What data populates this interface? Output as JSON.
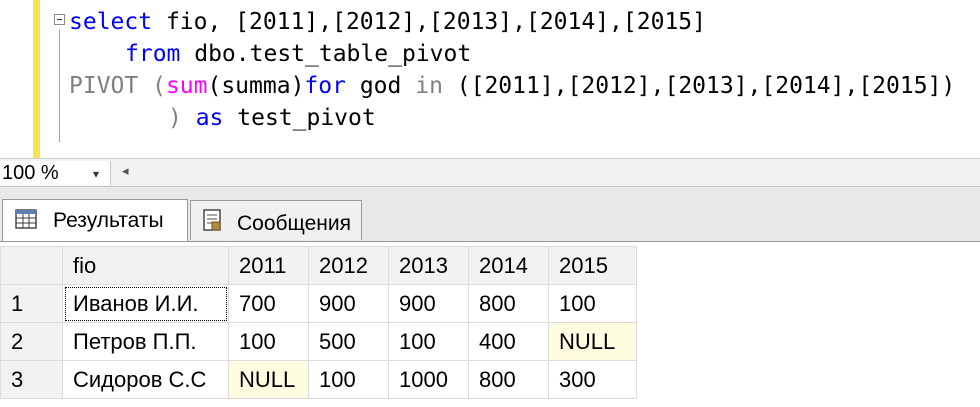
{
  "editor": {
    "lines": [
      {
        "kw1": "select",
        "t1": " fio, [2011],[2012],[2013],[2014],[2015]"
      },
      {
        "kw1": "from",
        "t1": " dbo.test_table_pivot"
      },
      {
        "g1": "PIVOT (",
        "fn1": "sum",
        "t1": "(summa)",
        "kw1": "for",
        "t2": " god ",
        "g2": "in",
        "t3": " ([2011],[2012],[2013],[2014],[2015])"
      },
      {
        "g1": ")",
        "kw1": " as",
        "t1": " test_pivot"
      }
    ]
  },
  "zoom": {
    "value": "100 %",
    "arrow": "▾",
    "scroll_left": "◂"
  },
  "tabs": [
    {
      "label": "Результаты"
    },
    {
      "label": "Сообщения"
    }
  ],
  "grid": {
    "headers": [
      "",
      "fio",
      "2011",
      "2012",
      "2013",
      "2014",
      "2015"
    ],
    "rows": [
      {
        "num": "1",
        "fio": "Иванов И.И.",
        "v2011": "700",
        "v2012": "900",
        "v2013": "900",
        "v2014": "800",
        "v2015": "100"
      },
      {
        "num": "2",
        "fio": "Петров П.П.",
        "v2011": "100",
        "v2012": "500",
        "v2013": "100",
        "v2014": "400",
        "v2015": "NULL"
      },
      {
        "num": "3",
        "fio": "Сидоров С.С",
        "v2011": "NULL",
        "v2012": "100",
        "v2013": "1000",
        "v2014": "800",
        "v2015": "300"
      }
    ]
  },
  "colors": {
    "keyword": "#0000ff",
    "function": "#ff00ff",
    "operator": "#808080",
    "null_cell": "#fffde1",
    "margin_marker": "#f3e74f"
  },
  "icons": {
    "results_tab": "grid-icon",
    "messages_tab": "document-icon"
  }
}
